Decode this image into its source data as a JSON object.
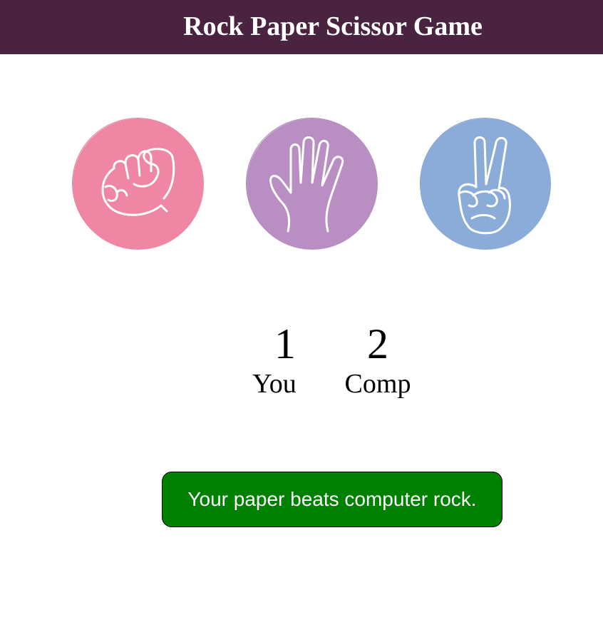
{
  "header": {
    "title": "Rock Paper Scissor Game",
    "background": "#4a2340"
  },
  "choices": [
    {
      "id": "rock",
      "icon": "fist-icon",
      "color": "#ee86a4"
    },
    {
      "id": "paper",
      "icon": "open-hand-icon",
      "color": "#b98fc3"
    },
    {
      "id": "scissors",
      "icon": "peace-hand-icon",
      "color": "#8bacd8"
    }
  ],
  "scoreboard": {
    "user_score": "1",
    "user_label": "You",
    "comp_score": "2",
    "comp_label": "Comp"
  },
  "message": {
    "text": "Your paper beats computer rock.",
    "background": "#008000"
  }
}
